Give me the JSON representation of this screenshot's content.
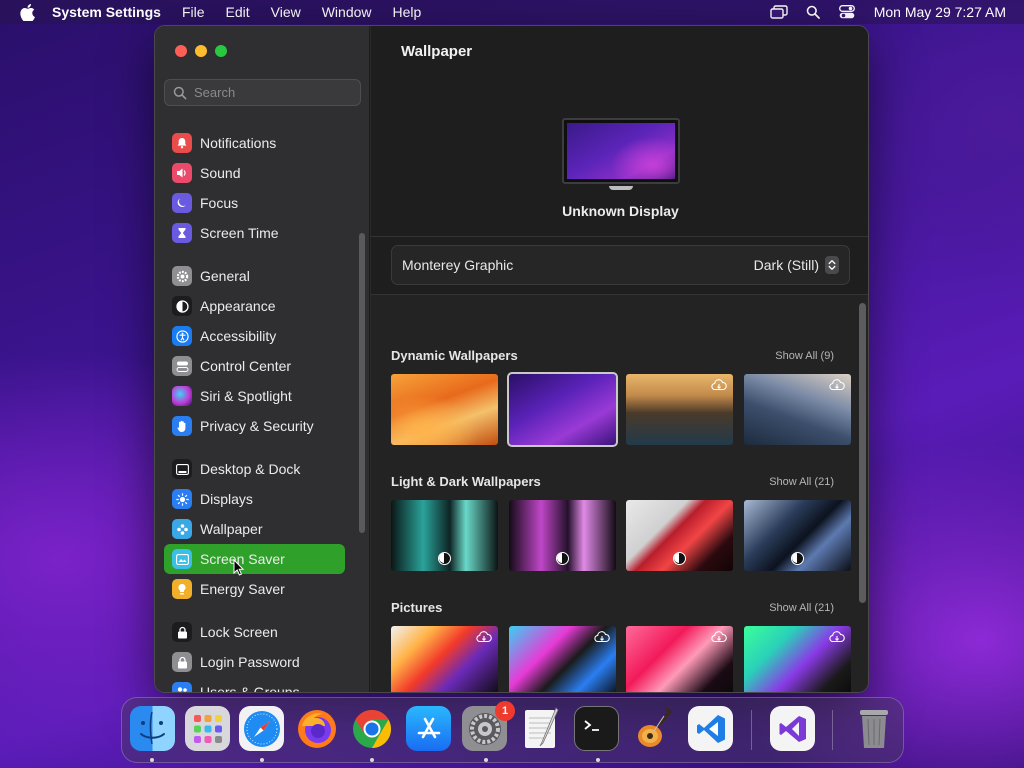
{
  "menubar": {
    "app_name": "System Settings",
    "menus": [
      "File",
      "Edit",
      "View",
      "Window",
      "Help"
    ],
    "clock": "Mon May 29  7:27 AM"
  },
  "sidebar": {
    "search_placeholder": "Search",
    "items": [
      {
        "label": "Notifications",
        "icon": "bell-icon",
        "color": "#ea4b4b"
      },
      {
        "label": "Sound",
        "icon": "speaker-icon",
        "color": "#ea4b6a"
      },
      {
        "label": "Focus",
        "icon": "moon-icon",
        "color": "#6a5ae0"
      },
      {
        "label": "Screen Time",
        "icon": "hourglass-icon",
        "color": "#6a5ae0"
      },
      {
        "label": "General",
        "icon": "gear-icon",
        "color": "#8e8e93"
      },
      {
        "label": "Appearance",
        "icon": "appearance-icon",
        "color": "#1c1c1e"
      },
      {
        "label": "Accessibility",
        "icon": "accessibility-icon",
        "color": "#1a7cf2"
      },
      {
        "label": "Control Center",
        "icon": "control-center-icon",
        "color": "#8e8e93"
      },
      {
        "label": "Siri & Spotlight",
        "icon": "siri-icon",
        "color": "#c23ad6"
      },
      {
        "label": "Privacy & Security",
        "icon": "hand-icon",
        "color": "#2a7ef2"
      },
      {
        "label": "Desktop & Dock",
        "icon": "dock-icon",
        "color": "#1c1c1e"
      },
      {
        "label": "Displays",
        "icon": "sun-icon",
        "color": "#2a7ef2"
      },
      {
        "label": "Wallpaper",
        "icon": "wallpaper-icon",
        "color": "#3aa8e6"
      },
      {
        "label": "Screen Saver",
        "icon": "screen-saver-icon",
        "color": "#3ac0e6"
      },
      {
        "label": "Energy Saver",
        "icon": "battery-icon",
        "color": "#f2b02a"
      },
      {
        "label": "Lock Screen",
        "icon": "lock-icon",
        "color": "#1c1c1e"
      },
      {
        "label": "Login Password",
        "icon": "padlock-icon",
        "color": "#8e8e93"
      },
      {
        "label": "Users & Groups",
        "icon": "users-icon",
        "color": "#2a7ef2"
      }
    ],
    "selected": "Screen Saver"
  },
  "main": {
    "title": "Wallpaper",
    "display_name": "Unknown Display",
    "picker": {
      "name": "Monterey Graphic",
      "value": "Dark (Still)"
    },
    "groups": [
      {
        "title": "Dynamic Wallpapers",
        "show_all": "Show All (9)"
      },
      {
        "title": "Light & Dark Wallpapers",
        "show_all": "Show All (21)"
      },
      {
        "title": "Pictures",
        "show_all": "Show All (21)"
      }
    ]
  },
  "dock": {
    "apps": [
      {
        "name": "Finder",
        "icon": "finder-icon",
        "running": true
      },
      {
        "name": "Launchpad",
        "icon": "launchpad-icon",
        "running": false
      },
      {
        "name": "Safari",
        "icon": "safari-icon",
        "running": true
      },
      {
        "name": "Firefox",
        "icon": "firefox-icon",
        "running": false
      },
      {
        "name": "Google Chrome",
        "icon": "chrome-icon",
        "running": true
      },
      {
        "name": "App Store",
        "icon": "app-store-icon",
        "running": false
      },
      {
        "name": "System Settings",
        "icon": "system-settings-icon",
        "running": true,
        "badge": "1"
      },
      {
        "name": "TextEdit",
        "icon": "textedit-icon",
        "running": false
      },
      {
        "name": "Terminal",
        "icon": "terminal-icon",
        "running": true
      },
      {
        "name": "GarageBand",
        "icon": "garageband-icon",
        "running": false
      },
      {
        "name": "Visual Studio Code",
        "icon": "vscode-icon",
        "running": false
      },
      {
        "name": "Visual Studio",
        "icon": "visual-studio-icon",
        "running": false
      },
      {
        "name": "Trash",
        "icon": "trash-icon",
        "running": false
      }
    ]
  }
}
